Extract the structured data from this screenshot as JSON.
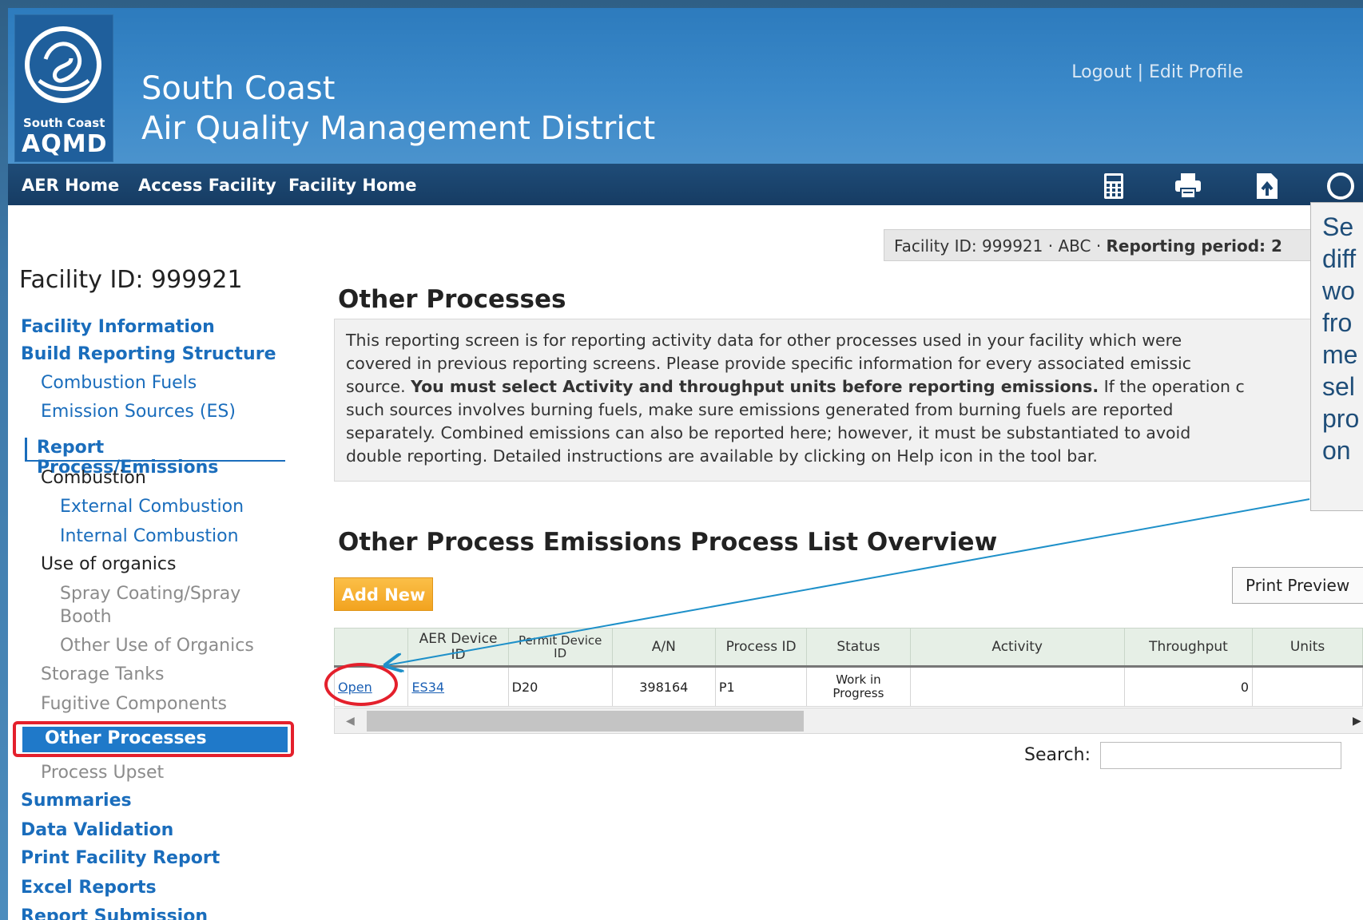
{
  "header": {
    "logo_small": "South Coast",
    "logo_big": "AQMD",
    "org_line1": "South Coast",
    "org_line2": "Air Quality Management District",
    "logout": "Logout",
    "separator": "|",
    "edit_profile": "Edit Profile"
  },
  "nav": {
    "items": [
      "AER Home",
      "Access Facility",
      "Facility Home"
    ],
    "tools": [
      "calculator-icon",
      "printer-icon",
      "upload-icon",
      "help-icon"
    ]
  },
  "facbar": {
    "prefix": "Facility ID: 999921 · ABC · ",
    "period_label": "Reporting period: 2"
  },
  "sidebar": {
    "title": "Facility ID: 999921",
    "facility_information": "Facility Information",
    "build_reporting_structure": "Build Reporting Structure",
    "combustion_fuels": "Combustion Fuels",
    "emission_sources": "Emission Sources (ES)",
    "report_process": "Report Process/Emissions",
    "combustion": "Combustion",
    "external_combustion": "External Combustion",
    "internal_combustion": "Internal Combustion",
    "use_of_organics": "Use of organics",
    "spray_coating_1": "Spray Coating/Spray",
    "spray_coating_2": "Booth",
    "other_use_organics": "Other Use of Organics",
    "storage_tanks": "Storage Tanks",
    "fugitive_components": "Fugitive Components",
    "other_processes": "Other Processes",
    "process_upset": "Process Upset",
    "summaries": "Summaries",
    "data_validation": "Data Validation",
    "print_facility_report": "Print Facility Report",
    "excel_reports": "Excel Reports",
    "report_submission": "Report Submission"
  },
  "main": {
    "title": "Other Processes",
    "intro_1": "This reporting screen is for reporting activity data for other processes used in your facility which were",
    "intro_2": "covered in previous reporting screens. Please provide specific information for every associated emissic",
    "intro_3a": "source. ",
    "intro_3b": "You must select Activity and throughput units before reporting emissions.",
    "intro_3c": " If the operation c",
    "intro_4": "such sources involves burning fuels, make sure emissions generated from burning fuels are reported",
    "intro_5": "separately. Combined emissions can also be reported here; however, it must be substantiated to avoid",
    "intro_6": "double reporting. Detailed instructions are available by clicking on Help icon in the tool bar.",
    "list_title": "Other Process Emissions Process List Overview",
    "add_new": "Add New",
    "print_preview": "Print Preview",
    "search_label": "Search:",
    "search_value": ""
  },
  "table": {
    "headers": [
      "",
      "AER Device ID",
      "Permit Device ID",
      "A/N",
      "Process ID",
      "Status",
      "Activity",
      "Throughput",
      "Units"
    ],
    "rows": [
      {
        "action": "Open",
        "aer_device_id": "ES34",
        "permit_device_id": "D20",
        "an": "398164",
        "process_id": "P1",
        "status": "Work in Progress",
        "activity": "",
        "throughput": "0",
        "units": ""
      }
    ]
  },
  "callout": {
    "lines": [
      "Se",
      "diff",
      "wo",
      "fro",
      "me",
      "sel",
      "pro",
      "on"
    ]
  },
  "colors": {
    "header_blue": "#3b89c9",
    "nav_dark": "#1a4570",
    "link_blue": "#1a6dbc",
    "accent_orange": "#f5a623",
    "highlight_red": "#e4202c"
  }
}
